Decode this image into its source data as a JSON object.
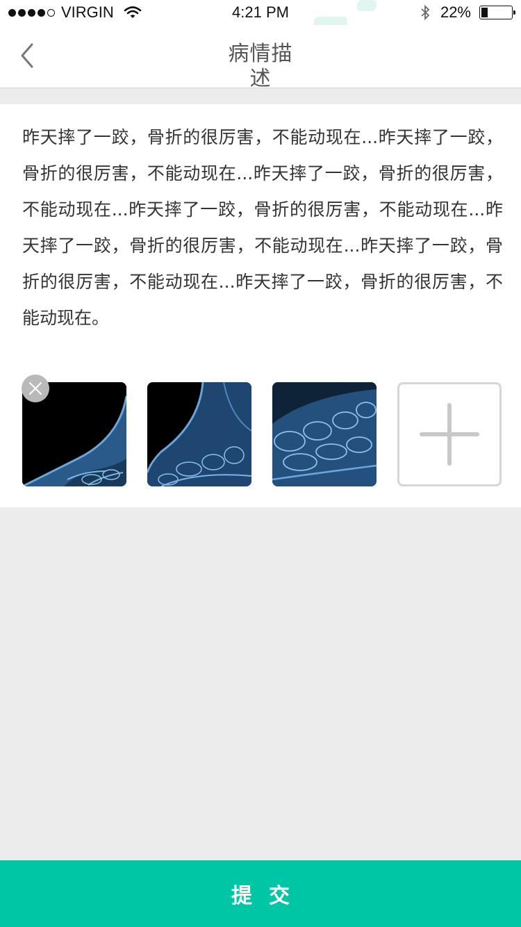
{
  "status_bar": {
    "carrier": "VIRGIN",
    "time": "4:21 PM",
    "battery_percent": "22%",
    "signal_bars_filled": 4,
    "signal_bars_total": 5,
    "battery_level": 0.22
  },
  "nav": {
    "title": "病情描述",
    "back_icon": "chevron-left-icon"
  },
  "description": {
    "text": "昨天摔了一跤，骨折的很厉害，不能动现在...昨天摔了一跤，骨折的很厉害，不能动现在...昨天摔了一跤，骨折的很厉害，不能动现在...昨天摔了一跤，骨折的很厉害，不能动现在...昨天摔了一跤，骨折的很厉害，不能动现在...昨天摔了一跤，骨折的很厉害，不能动现在...昨天摔了一跤，骨折的很厉害，不能动现在。"
  },
  "photos": {
    "items": [
      {
        "image": "foot-xray-heel",
        "removable": true
      },
      {
        "image": "foot-xray-ankle",
        "removable": false
      },
      {
        "image": "foot-xray-toes",
        "removable": false
      }
    ],
    "remove_icon": "close-icon",
    "add_icon": "plus-icon"
  },
  "submit": {
    "label": "提交"
  },
  "colors": {
    "accent": "#00c6a6",
    "background": "#ececec",
    "card": "#ffffff",
    "text": "#333333",
    "title": "#555555"
  }
}
